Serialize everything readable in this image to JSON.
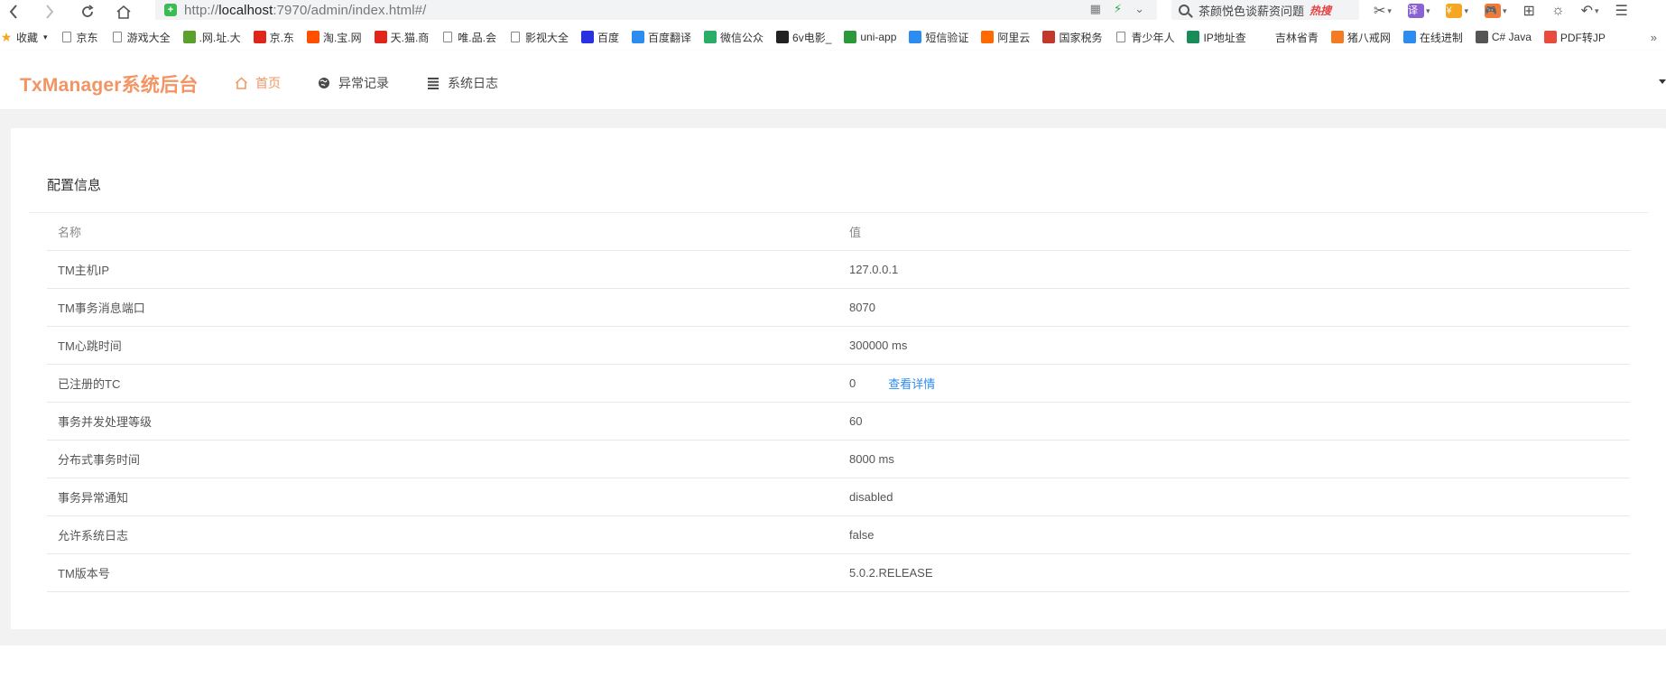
{
  "browser": {
    "url_prefix": "http://",
    "url_host": "localhost",
    "url_rest": ":7970/admin/index.html#/",
    "search_text": "茶颜悦色谈薪资问题",
    "search_badge": "热搜"
  },
  "bookmarks": [
    {
      "label": "收藏",
      "icon": "star-icon"
    },
    {
      "label": "京东",
      "icon": "doc-icon"
    },
    {
      "label": "游戏大全",
      "icon": "doc-icon"
    },
    {
      "label": ".网.址.大",
      "icon": "hao-icon",
      "color": "#5aa02c"
    },
    {
      "label": "京.东",
      "icon": "jd-icon",
      "color": "#e1251b"
    },
    {
      "label": "淘.宝.网",
      "icon": "taobao-icon",
      "color": "#ff5000"
    },
    {
      "label": "天.猫.商",
      "icon": "tmall-icon",
      "color": "#e1251b"
    },
    {
      "label": "唯.品.会",
      "icon": "doc-icon"
    },
    {
      "label": "影视大全",
      "icon": "doc-icon"
    },
    {
      "label": "百度",
      "icon": "baidu-icon",
      "color": "#2932e1"
    },
    {
      "label": "百度翻译",
      "icon": "translate-icon",
      "color": "#2d8cf0"
    },
    {
      "label": "微信公众",
      "icon": "wechat-icon",
      "color": "#2aae67"
    },
    {
      "label": "6v电影_",
      "icon": "6v-icon",
      "color": "#222222"
    },
    {
      "label": "uni-app",
      "icon": "uniapp-icon",
      "color": "#2b9939"
    },
    {
      "label": "短信验证",
      "icon": "sms-icon",
      "color": "#2d8cf0"
    },
    {
      "label": "阿里云",
      "icon": "aliyun-icon",
      "color": "#ff6a00"
    },
    {
      "label": "国家税务",
      "icon": "tax-icon",
      "color": "#c0392b"
    },
    {
      "label": "青少年人",
      "icon": "doc-icon"
    },
    {
      "label": "IP地址查",
      "icon": "ip-icon",
      "color": "#1a8c5a"
    },
    {
      "label": "吉林省青",
      "icon": "blank-icon"
    },
    {
      "label": "猪八戒网",
      "icon": "zbj-icon",
      "color": "#f27b24"
    },
    {
      "label": "在线进制",
      "icon": "convert-icon",
      "color": "#2d8cf0"
    },
    {
      "label": "C# Java",
      "icon": "code-icon",
      "color": "#555555"
    },
    {
      "label": "PDF转JP",
      "icon": "pdf-icon",
      "color": "#e84c3d"
    }
  ],
  "app": {
    "title": "TxManager系统后台",
    "nav": [
      {
        "label": "首页",
        "icon": "home-icon",
        "active": true
      },
      {
        "label": "异常记录",
        "icon": "globe-icon",
        "active": false
      },
      {
        "label": "系统日志",
        "icon": "list-icon",
        "active": false
      }
    ]
  },
  "config": {
    "title": "配置信息",
    "headers": {
      "name": "名称",
      "value": "值"
    },
    "rows": [
      {
        "name": "TM主机IP",
        "value": "127.0.0.1"
      },
      {
        "name": "TM事务消息端口",
        "value": "8070"
      },
      {
        "name": "TM心跳时间",
        "value": "300000 ms"
      },
      {
        "name": "已注册的TC",
        "value": "0",
        "link": "查看详情"
      },
      {
        "name": "事务并发处理等级",
        "value": "60"
      },
      {
        "name": "分布式事务时间",
        "value": "8000 ms"
      },
      {
        "name": "事务异常通知",
        "value": "disabled"
      },
      {
        "name": "允许系统日志",
        "value": "false"
      },
      {
        "name": "TM版本号",
        "value": "5.0.2.RELEASE"
      }
    ]
  },
  "colors": {
    "accent": "#f39563",
    "link": "#2d8cf0"
  }
}
